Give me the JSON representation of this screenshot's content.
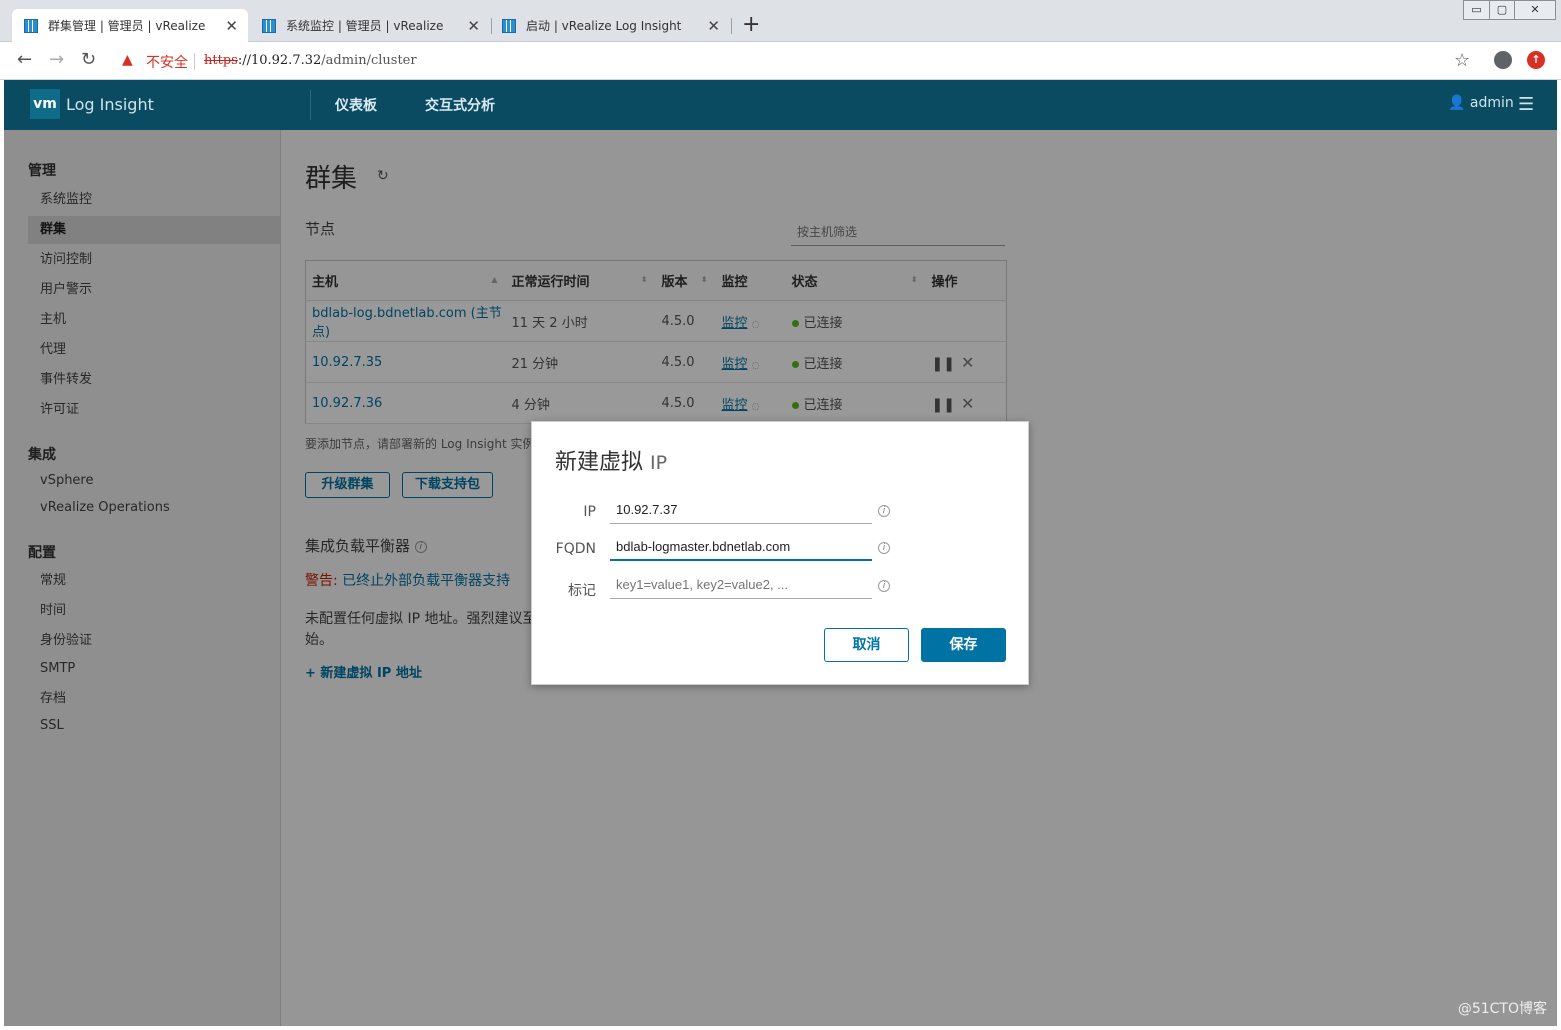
{
  "browser": {
    "tabs": [
      {
        "title": "群集管理 | 管理员 | vRealize",
        "close": "✕"
      },
      {
        "title": "系统监控 | 管理员 | vRealize",
        "close": "✕"
      },
      {
        "title": "启动 | vRealize Log Insight",
        "close": "✕"
      }
    ],
    "new_tab": "+",
    "window_controls": [
      "▭",
      "▢",
      "✕"
    ],
    "nav": {
      "back": "←",
      "forward": "→",
      "reload": "↻"
    },
    "security_warning": "不安全",
    "url_scheme": "https",
    "url_host": "://10.92.7.32",
    "url_path": "/admin/cluster"
  },
  "app": {
    "logo": "vm",
    "product": "Log Insight",
    "nav": [
      "仪表板",
      "交互式分析"
    ],
    "user": "admin"
  },
  "sidebar": {
    "groups": [
      {
        "title": "管理",
        "items": [
          "系统监控",
          "群集",
          "访问控制",
          "用户警示",
          "主机",
          "代理",
          "事件转发",
          "许可证"
        ]
      },
      {
        "title": "集成",
        "items": [
          "vSphere",
          "vRealize Operations"
        ]
      },
      {
        "title": "配置",
        "items": [
          "常规",
          "时间",
          "身份验证",
          "SMTP",
          "存档",
          "SSL"
        ]
      }
    ],
    "active": "群集"
  },
  "main": {
    "title": "群集",
    "nodes_label": "节点",
    "filter_placeholder": "按主机筛选",
    "table": {
      "headers": [
        "主机",
        "正常运行时间",
        "版本",
        "监控",
        "状态",
        "操作"
      ],
      "rows": [
        {
          "host": "bdlab-log.bdnetlab.com (主节点)",
          "uptime": "11 天 2 小时",
          "version": "4.5.0",
          "monitor": "监控",
          "status": "已连接"
        },
        {
          "host": "10.92.7.35",
          "uptime": "21 分钟",
          "version": "4.5.0",
          "monitor": "监控",
          "status": "已连接"
        },
        {
          "host": "10.92.7.36",
          "uptime": "4 分钟",
          "version": "4.5.0",
          "monitor": "监控",
          "status": "已连接"
        }
      ]
    },
    "hint": "要添加节点，请部署新的 Log Insight 实例",
    "upgrade_button": "升级群集",
    "download_button": "下载支持包",
    "lb_title": "集成负载平衡器",
    "warning_prefix": "警告:",
    "warning_link": "已终止外部负载平衡器支持",
    "lb_body": "未配置任何虚拟 IP 地址。强烈建议至\n始。",
    "add_vip_link": "+ 新建虚拟 IP 地址"
  },
  "modal": {
    "title": "新建虚拟",
    "title_suffix": "IP",
    "fields": {
      "ip_label": "IP",
      "ip_value": "10.92.7.37",
      "fqdn_label": "FQDN",
      "fqdn_value": "bdlab-logmaster.bdnetlab.com",
      "tags_label": "标记",
      "tags_placeholder": "key1=value1, key2=value2, ..."
    },
    "cancel": "取消",
    "save": "保存"
  },
  "watermark": "@51CTO博客",
  "colors": {
    "header": "#0a4b62",
    "link": "#0072a3",
    "connected": "#60b515",
    "warning": "#c92100"
  }
}
